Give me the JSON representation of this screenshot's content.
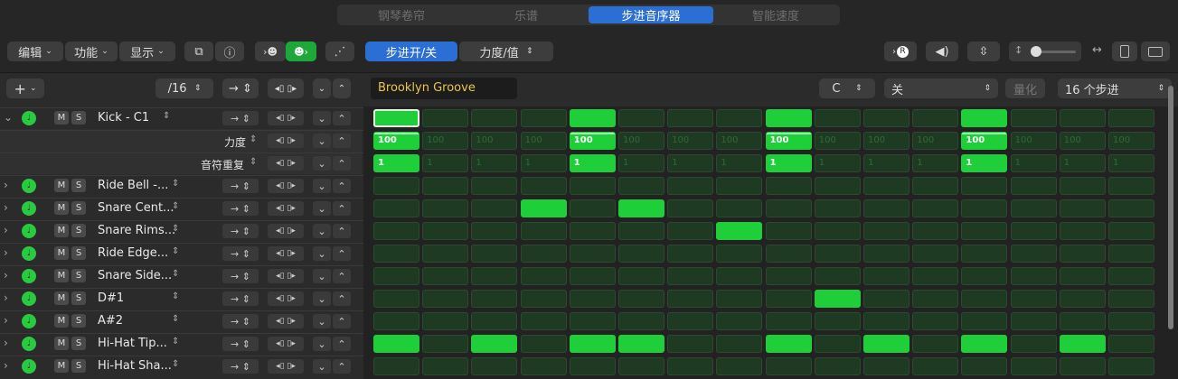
{
  "tabs": [
    "钢琴卷帘",
    "乐谱",
    "步进音序器",
    "智能速度"
  ],
  "active_tab": 2,
  "toolbar": {
    "edit": "编辑",
    "function": "功能",
    "view": "显示",
    "step_onoff": "步进开/关",
    "velocity_value": "力度/值",
    "record_badge": "R"
  },
  "pattern": {
    "add": "+",
    "step_rate": "/16",
    "name": "Brooklyn Groove",
    "key": "C",
    "scale": "关",
    "quantize": "量化",
    "length": "16 个步进"
  },
  "rows": [
    {
      "name": "Kick - C1",
      "expanded": true,
      "steps": [
        1,
        0,
        0,
        0,
        1,
        0,
        0,
        0,
        1,
        0,
        0,
        0,
        1,
        0,
        0,
        0
      ]
    },
    {
      "name": "Ride Bell -...",
      "steps": [
        0,
        0,
        0,
        0,
        0,
        0,
        0,
        0,
        0,
        0,
        0,
        0,
        0,
        0,
        0,
        0
      ]
    },
    {
      "name": "Snare Cent...",
      "steps": [
        0,
        0,
        0,
        1,
        0,
        1,
        0,
        0,
        0,
        0,
        0,
        0,
        0,
        0,
        0,
        0
      ]
    },
    {
      "name": "Snare Rims...",
      "steps": [
        0,
        0,
        0,
        0,
        0,
        0,
        0,
        1,
        0,
        0,
        0,
        0,
        0,
        0,
        0,
        0
      ]
    },
    {
      "name": "Ride Edge...",
      "steps": [
        0,
        0,
        0,
        0,
        0,
        0,
        0,
        0,
        0,
        0,
        0,
        0,
        0,
        0,
        0,
        0
      ]
    },
    {
      "name": "Snare Side...",
      "steps": [
        0,
        0,
        0,
        0,
        0,
        0,
        0,
        0,
        0,
        0,
        0,
        0,
        0,
        0,
        0,
        0
      ]
    },
    {
      "name": "D#1",
      "steps": [
        0,
        0,
        0,
        0,
        0,
        0,
        0,
        0,
        0,
        1,
        0,
        0,
        0,
        0,
        0,
        0
      ]
    },
    {
      "name": "A#2",
      "steps": [
        0,
        0,
        0,
        0,
        0,
        0,
        0,
        0,
        0,
        0,
        0,
        0,
        0,
        0,
        0,
        0
      ]
    },
    {
      "name": "Hi-Hat Tip...",
      "steps": [
        1,
        0,
        1,
        0,
        1,
        1,
        0,
        0,
        1,
        0,
        1,
        0,
        1,
        0,
        1,
        0
      ]
    },
    {
      "name": "Hi-Hat Sha...",
      "steps": [
        0,
        0,
        0,
        0,
        0,
        0,
        0,
        0,
        0,
        0,
        0,
        0,
        0,
        0,
        0,
        0
      ]
    }
  ],
  "subrows": [
    {
      "label": "力度",
      "on_value": "100",
      "off_value": "100"
    },
    {
      "label": "音符重复",
      "on_value": "1",
      "off_value": "1"
    }
  ],
  "ms": {
    "m": "M",
    "s": "S"
  },
  "colors": {
    "accent": "#2c6fd4",
    "step_on": "#1fcf3a",
    "step_off": "#1f3a22"
  }
}
